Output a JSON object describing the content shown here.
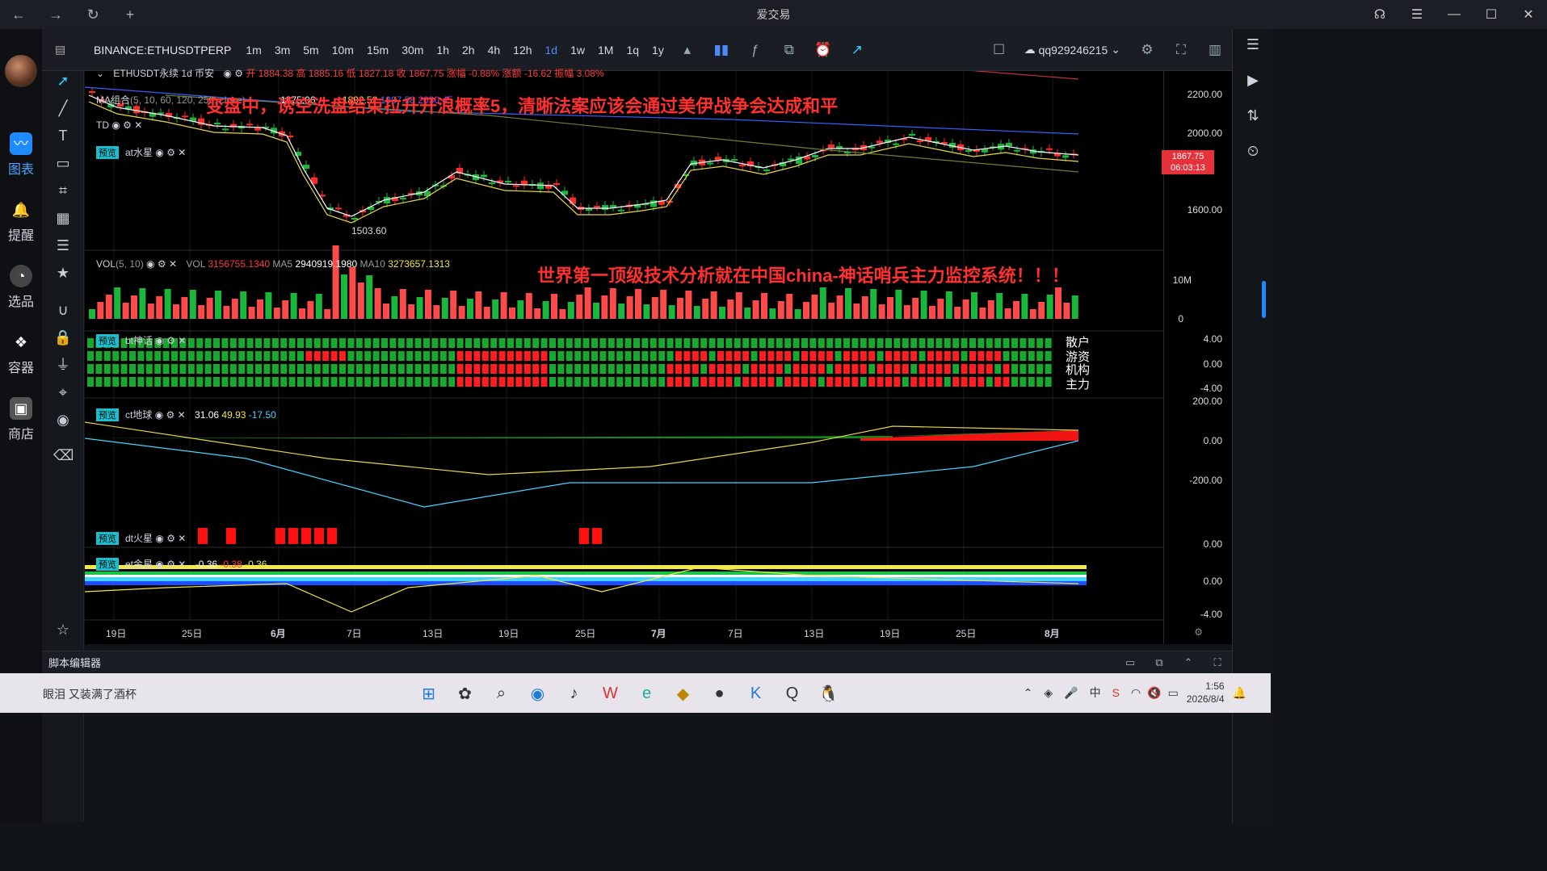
{
  "window": {
    "title": "爱交易"
  },
  "left_nav": {
    "items": [
      {
        "label": "图表"
      },
      {
        "label": "提醒"
      },
      {
        "label": "选品"
      },
      {
        "label": "容器"
      },
      {
        "label": "商店"
      }
    ]
  },
  "toolbar": {
    "symbol": "BINANCE:ETHUSDTPERP",
    "timeframes": [
      "1m",
      "3m",
      "5m",
      "10m",
      "15m",
      "30m",
      "1h",
      "2h",
      "4h",
      "12h",
      "1d",
      "1w",
      "1M",
      "1q",
      "1y"
    ],
    "active_timeframe": "1d",
    "user": "qq929246215"
  },
  "main_legend": {
    "name": "ETHUSDT永续 1d 币安",
    "open_label": "开",
    "open": "1884.38",
    "high_label": "高",
    "high": "1885.16",
    "low_label": "低",
    "low": "1827.18",
    "close_label": "收",
    "close": "1867.75",
    "change_pct_label": "涨幅",
    "change_pct": "-0.88%",
    "change_label": "涨额",
    "change": "-16.62",
    "amp_label": "振幅",
    "amp": "3.08%"
  },
  "ma_legend": {
    "name": "MA组合",
    "params": "(5, 10, 60, 120, 250, close)",
    "v1": "1875.06",
    "v2": "1892.52",
    "v3": "1987.58",
    "v4": "2030.45"
  },
  "td_legend": {
    "name": "TD"
  },
  "at_legend": {
    "badge": "预览",
    "name": "at水星"
  },
  "overlay_text_1": "变盘中，诱空洗盘结束拉升开浪概率5，清晰法案应该会通过美伊战争会达成和平",
  "overlay_text_2": "世界第一顶级技术分析就在中国china-神话哨兵主力监控系统！！！",
  "vol_legend": {
    "name": "VOL",
    "params": "(5, 10)",
    "vol_label": "VOL",
    "vol": "3156755.1340",
    "ma5_label": "MA5",
    "ma5": "2940919.1980",
    "ma10_label": "MA10",
    "ma10": "3273657.1313"
  },
  "bt_legend": {
    "badge": "预览",
    "name": "bt神话",
    "rows": [
      "散户",
      "游资",
      "机构",
      "主力"
    ]
  },
  "ct_legend": {
    "badge": "预览",
    "name": "ct地球",
    "v1": "31.06",
    "v2": "49.93",
    "v3": "-17.50"
  },
  "dt_legend": {
    "badge": "预览",
    "name": "dt火星"
  },
  "et_legend": {
    "badge": "预览",
    "name": "et金星",
    "v1": "-0.36",
    "v2": "-0.38",
    "v3": "-0.36"
  },
  "price_scale": {
    "main": [
      "2200.00",
      "2000.00",
      "1600.00"
    ],
    "vol": [
      "10M",
      "0"
    ],
    "bt": [
      "4.00",
      "0.00",
      "-4.00"
    ],
    "ct": [
      "200.00",
      "0.00",
      "-200.00"
    ],
    "dt": [
      "0.00"
    ],
    "et": [
      "0.00",
      "-4.00"
    ],
    "last_price": "1867.75",
    "countdown": "06:03:13"
  },
  "time_axis": [
    "19日",
    "25日",
    "6月",
    "7日",
    "13日",
    "19日",
    "25日",
    "7月",
    "7日",
    "13日",
    "19日",
    "25日",
    "8月"
  ],
  "low_annotation": "1503.60",
  "bottom": {
    "script_editor": "脚本编辑器"
  },
  "taskbar": {
    "song": "眼泪 又装满了酒杯",
    "time": "1:56",
    "date": "2026/8/4"
  }
}
